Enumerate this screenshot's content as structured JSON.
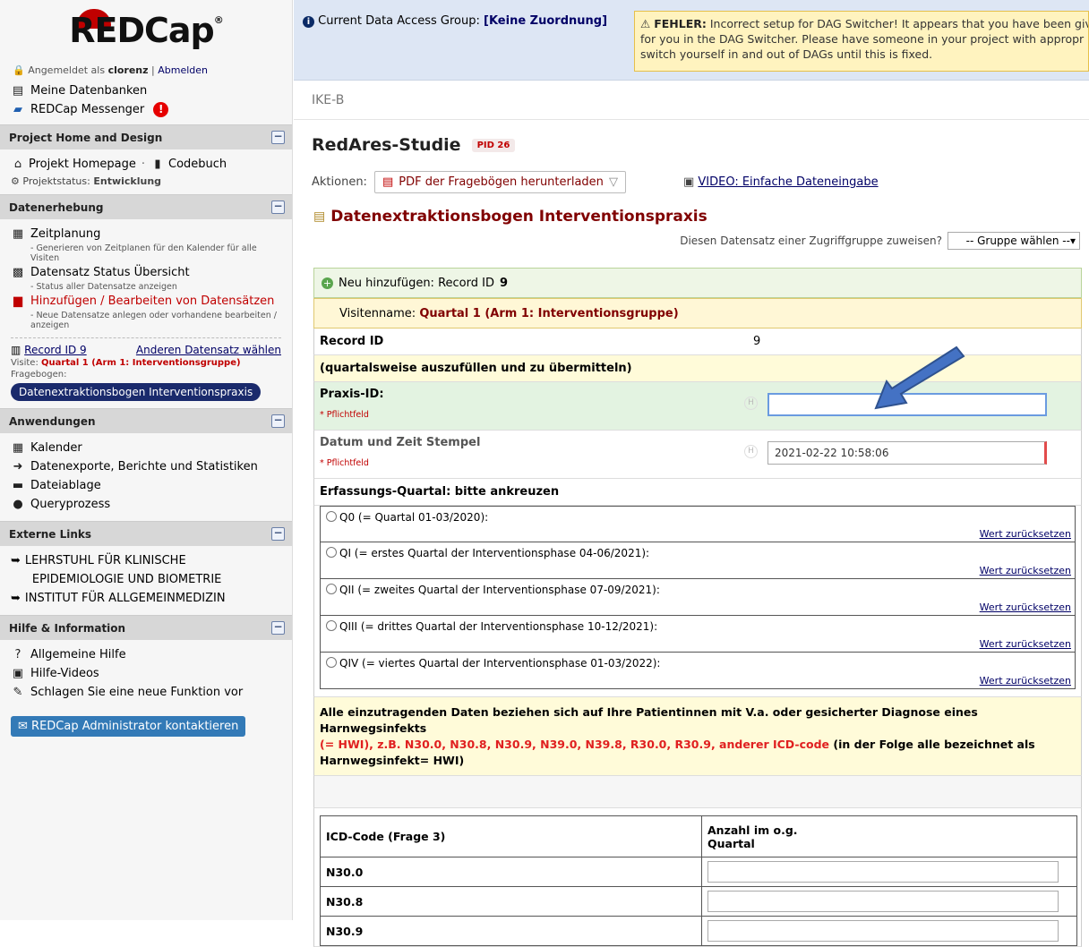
{
  "sidebar": {
    "logo_text": "REDCap",
    "logo_reg": "®",
    "login_prefix": "Angemeldet als",
    "user": "clorenz",
    "separator": "|",
    "logout": "Abmelden",
    "links": [
      {
        "label": "Meine Datenbanken",
        "icon": "list-icon"
      },
      {
        "label": "REDCap Messenger",
        "icon": "chat-icon"
      }
    ],
    "messenger_badge": "!",
    "sections": {
      "project_home": {
        "title": "Project Home and Design",
        "homepage": "Projekt Homepage",
        "dot": "·",
        "codebook": "Codebuch",
        "status_label": "Projektstatus:",
        "status_value": "Entwicklung"
      },
      "data_collection": {
        "title": "Datenerhebung",
        "scheduling": "Zeitplanung",
        "scheduling_note": "- Generieren von Zeitplanen für den Kalender für alle Visiten",
        "status_overview": "Datensatz Status Übersicht",
        "status_note": "- Status aller Datensatze anzeigen",
        "add_edit": "Hinzufügen / Bearbeiten von Datensätzen",
        "add_edit_note": "- Neue Datensatze anlegen oder vorhandene bearbeiten / anzeigen",
        "record_id": "Record ID 9",
        "choose_other": "Anderen Datensatz wählen",
        "visit_label": "Visite:",
        "visit_value": "Quartal 1 (Arm 1: Interventionsgruppe)",
        "form_label": "Fragebogen:",
        "form_pill": "Datenextraktionsbogen Interventionspraxis"
      },
      "applications": {
        "title": "Anwendungen",
        "items": [
          "Kalender",
          "Datenexporte, Berichte und Statistiken",
          "Dateiablage",
          "Queryprozess"
        ]
      },
      "external": {
        "title": "Externe Links",
        "link1_line1": "LEHRSTUHL FÜR KLINISCHE",
        "link1_line2": "EPIDEMIOLOGIE UND BIOMETRIE",
        "link2": "INSTITUT FÜR ALLGEMEINMEDIZIN"
      },
      "help": {
        "title": "Hilfe & Information",
        "items": [
          "Allgemeine Hilfe",
          "Hilfe-Videos",
          "Schlagen Sie eine neue Funktion vor"
        ],
        "admin_button": "REDCap Administrator kontaktieren"
      }
    },
    "collapse_glyph": "−"
  },
  "topbar": {
    "dag_label": "Current Data Access Group:",
    "dag_value": "[Keine Zuordnung]",
    "warn_title": "FEHLER:",
    "warn_line1": "Incorrect setup for DAG Switcher! It appears that you have been giv",
    "warn_line2": "for you in the DAG Switcher. Please have someone in your project with appropr",
    "warn_line3": "switch yourself in and out of DAGs until this is fixed."
  },
  "crumb": "IKE-B",
  "project": {
    "title": "RedAres-Studie",
    "pid": "PID 26"
  },
  "actions": {
    "label": "Aktionen:",
    "pdf_button": "PDF der Fragebögen herunterladen",
    "video_link": "VIDEO: Einfache Dateneingabe"
  },
  "form": {
    "title": "Datenextraktionsbogen Interventionspraxis",
    "dag_assign_label": "Diesen Datensatz einer Zugriffgruppe zuweisen?",
    "dag_select_value": "-- Gruppe wählen --",
    "new_record": "Neu hinzufügen: Record ID",
    "new_record_id": "9",
    "visit_prefix": "Visitenname:",
    "visit_value": "Quartal 1 (Arm 1: Interventionsgruppe)",
    "record_id_label": "Record ID",
    "record_id_value": "9",
    "section_header": "(quartalsweise auszufüllen und zu übermitteln)",
    "praxis_label": "Praxis-ID:",
    "required": "* Pflichtfeld",
    "praxis_value": "",
    "timestamp_label": "Datum und Zeit Stempel",
    "timestamp_value": "2021-02-22 10:58:06",
    "h_icon": "H",
    "quarter_label": "Erfassungs-Quartal: bitte ankreuzen",
    "quarter_options": [
      "Q0 (= Quartal 01-03/2020):",
      "QI (= erstes Quartal der Interventionsphase 04-06/2021):",
      "QII (= zweites Quartal der Interventionsphase 07-09/2021):",
      "QIII (= drittes Quartal der Interventionsphase 10-12/2021):",
      "QIV (= viertes Quartal der Interventionsphase 01-03/2022):"
    ],
    "reset_label": "Wert zurücksetzen",
    "info_line1": "Alle einzutragenden Daten beziehen sich auf Ihre Patientinnen mit V.a. oder gesicherter Diagnose eines",
    "info_line2": "Harnwegsinfekts",
    "info_line3_red": "(= HWI), z.B. N30.0, N30.8, N30.9, N39.0, N39.8, R30.0, R30.9, anderer ICD-code",
    "info_line3_black": "(in der Folge alle bezeichnet als",
    "info_line4": "Harnwegsinfekt= HWI)",
    "table_head_code": "ICD-Code (Frage 3)",
    "table_head_count_1": "Anzahl im o.g.",
    "table_head_count_2": "Quartal",
    "table_rows": [
      "N30.0",
      "N30.8",
      "N30.9"
    ]
  }
}
